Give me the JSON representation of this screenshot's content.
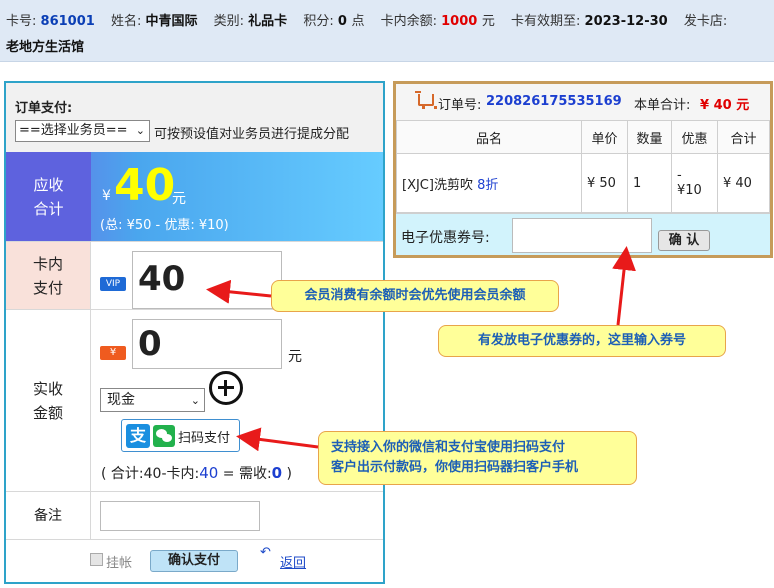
{
  "card_info": {
    "card_no_label": "卡号:",
    "card_no": "861001",
    "name_label": "姓名:",
    "name": "中青国际",
    "type_label": "类别:",
    "type": "礼品卡",
    "points_label": "积分:",
    "points": "0",
    "points_unit": "点",
    "balance_label": "卡内余额:",
    "balance": "1000",
    "balance_unit": "元",
    "expiry_label": "卡有效期至:",
    "expiry": "2023-12-30",
    "issuer_label": "发卡店:",
    "issuer": "老地方生活馆"
  },
  "payment": {
    "title": "订单支付:",
    "staff_select": "==选择业务员==",
    "staff_hint": "可按预设值对业务员进行提成分配",
    "due_label_1": "应收",
    "due_label_2": "合计",
    "due_currency": "¥",
    "due_amount": "40",
    "due_unit": "元",
    "due_detail": "(总: ¥50 - 优惠: ¥10)",
    "card_label_1": "卡内",
    "card_label_2": "支付",
    "vip_badge": "VIP",
    "card_amount": "40",
    "paid_label_1": "实收",
    "paid_label_2": "金额",
    "cash_badge": "¥",
    "paid_amount": "0",
    "paid_unit": "元",
    "method": "现金",
    "scan_pay_label": "扫码支付",
    "alipay_glyph": "支",
    "calc_prefix": "( 合计:40-卡内:",
    "calc_card": "40",
    "calc_mid": " = 需收:",
    "calc_need": "0",
    "calc_suffix": " )",
    "note_label": "备注",
    "note_value": "",
    "on_credit_label": "挂帐",
    "confirm_label": "确认支付",
    "back_label": "返回"
  },
  "order": {
    "order_no_label": "订单号:",
    "order_no": "220826175535169",
    "total_label": "本单合计:",
    "total": "¥ 40 元",
    "columns": [
      "品名",
      "单价",
      "数量",
      "优惠",
      "合计"
    ],
    "items": [
      {
        "name": "[XJC]洗剪吹",
        "discount_rate": "8折",
        "price": "¥ 50",
        "qty": "1",
        "discount_1": "-",
        "discount_2": "¥10",
        "total": "¥ 40"
      }
    ],
    "coupon_label": "电子优惠券号:",
    "coupon_value": "",
    "coupon_button": "确 认"
  },
  "callouts": {
    "card_balance": "会员消费有余额时会优先使用会员余额",
    "coupon": "有发放电子优惠券的，这里输入券号",
    "scan_line_1": "支持接入你的微信和支付宝使用扫码支付",
    "scan_line_2": "客户出示付款码，你使用扫码器扫客户手机"
  },
  "colors": {
    "accent_blue": "#1c3fd0",
    "money_red": "#e00000",
    "due_yellow": "#ffff00",
    "callout_bg": "#ffff99",
    "arrow_red": "#e81a1a"
  }
}
